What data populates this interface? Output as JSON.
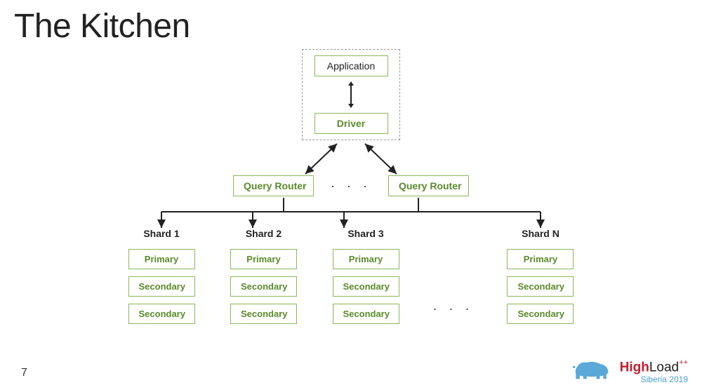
{
  "slide": {
    "title": "The Kitchen",
    "page_number": "7"
  },
  "diagram": {
    "app_group": {
      "application_label": "Application",
      "driver_label": "Driver"
    },
    "routers": {
      "left_label": "Query Router",
      "right_label": "Query Router",
      "ellipsis": "· · ·"
    },
    "shards": {
      "ellipsis": "· · ·",
      "columns": [
        {
          "title": "Shard 1",
          "primary": "Primary",
          "secondary1": "Secondary",
          "secondary2": "Secondary"
        },
        {
          "title": "Shard 2",
          "primary": "Primary",
          "secondary1": "Secondary",
          "secondary2": "Secondary"
        },
        {
          "title": "Shard 3",
          "primary": "Primary",
          "secondary1": "Secondary",
          "secondary2": "Secondary"
        },
        {
          "title": "Shard N",
          "primary": "Primary",
          "secondary1": "Secondary",
          "secondary2": "Secondary"
        }
      ]
    }
  },
  "branding": {
    "high": "High",
    "load": "Load",
    "plus": "++",
    "subtitle": "Siberia 2019"
  }
}
